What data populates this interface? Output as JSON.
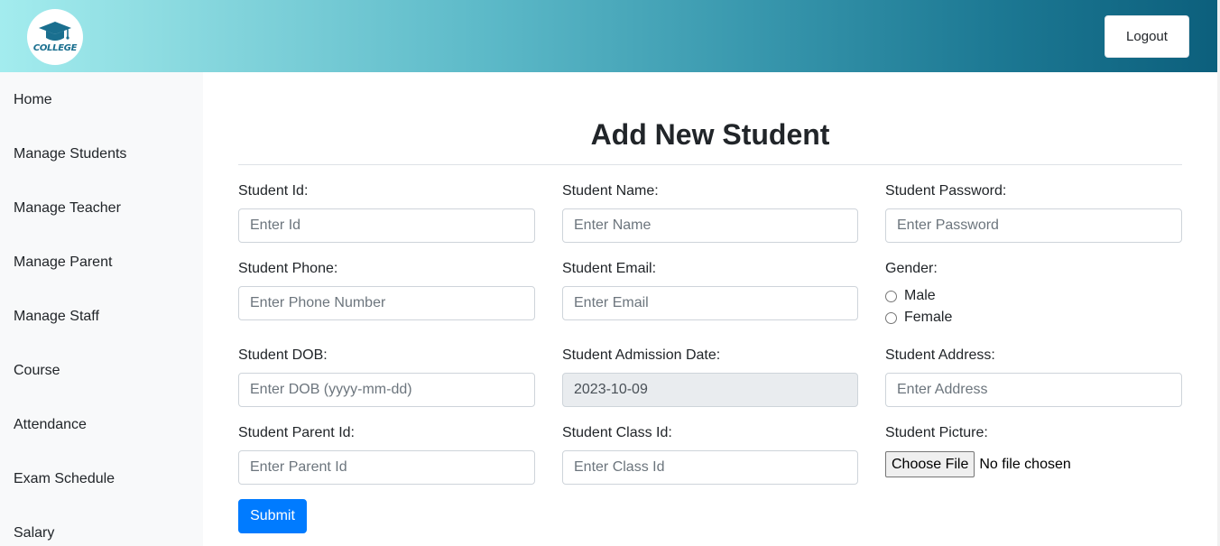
{
  "header": {
    "logo_text": "COLLEGE",
    "logout_label": "Logout"
  },
  "sidebar": {
    "items": [
      {
        "label": "Home"
      },
      {
        "label": "Manage Students"
      },
      {
        "label": "Manage Teacher"
      },
      {
        "label": "Manage Parent"
      },
      {
        "label": "Manage Staff"
      },
      {
        "label": "Course"
      },
      {
        "label": "Attendance"
      },
      {
        "label": "Exam Schedule"
      },
      {
        "label": "Salary"
      }
    ]
  },
  "form": {
    "title": "Add New Student",
    "student_id": {
      "label": "Student Id:",
      "placeholder": "Enter Id",
      "value": ""
    },
    "student_name": {
      "label": "Student Name:",
      "placeholder": "Enter Name",
      "value": ""
    },
    "student_password": {
      "label": "Student Password:",
      "placeholder": "Enter Password",
      "value": ""
    },
    "student_phone": {
      "label": "Student Phone:",
      "placeholder": "Enter Phone Number",
      "value": ""
    },
    "student_email": {
      "label": "Student Email:",
      "placeholder": "Enter Email",
      "value": ""
    },
    "gender": {
      "label": "Gender:",
      "options": [
        "Male",
        "Female"
      ],
      "selected": ""
    },
    "student_dob": {
      "label": "Student DOB:",
      "placeholder": "Enter DOB (yyyy-mm-dd)",
      "value": ""
    },
    "student_admission_date": {
      "label": "Student Admission Date:",
      "value": "2023-10-09"
    },
    "student_address": {
      "label": "Student Address:",
      "placeholder": "Enter Address",
      "value": ""
    },
    "student_parent_id": {
      "label": "Student Parent Id:",
      "placeholder": "Enter Parent Id",
      "value": ""
    },
    "student_class_id": {
      "label": "Student Class Id:",
      "placeholder": "Enter Class Id",
      "value": ""
    },
    "student_picture": {
      "label": "Student Picture:",
      "button_label": "Choose File",
      "status": "No file chosen"
    },
    "submit_label": "Submit"
  },
  "colors": {
    "primary": "#007bff",
    "sidebar_bg": "#f8f9fa",
    "header_gradient_start": "#a3ecee",
    "header_gradient_end": "#0c5f7c",
    "readonly_bg": "#e9ecef"
  },
  "icons": {
    "logo": "graduation-cap-icon"
  }
}
